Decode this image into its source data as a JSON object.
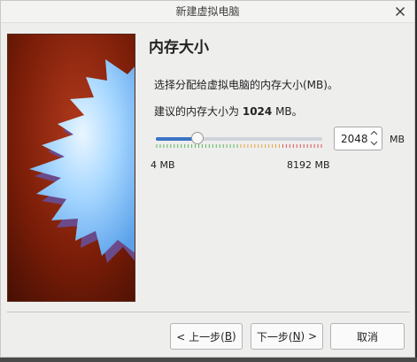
{
  "window": {
    "title": "新建虚拟电脑"
  },
  "page": {
    "heading": "内存大小",
    "description": "选择分配给虚拟电脑的内存大小(MB)。",
    "recommend_prefix": "建议的内存大小为",
    "recommend_value": "1024",
    "recommend_suffix": "MB。"
  },
  "memory": {
    "value": "2048",
    "min_label": "4 MB",
    "max_label": "8192 MB",
    "unit": "MB",
    "min": 4,
    "max": 8192,
    "current": 2048,
    "recommended": 1024,
    "colors": {
      "accent": "#3b74c6",
      "safe": "#5cb85c",
      "warn": "#e8a33d",
      "danger": "#d9534f"
    }
  },
  "buttons": {
    "back": {
      "text": "< 上一步(",
      "key": "B",
      "close": ")"
    },
    "next": {
      "text": "下一步(",
      "key": "N",
      "close": ") >"
    },
    "cancel": "取消"
  },
  "icons": {
    "close": "close-icon",
    "spin_up": "chevron-up-icon",
    "spin_down": "chevron-down-icon",
    "art": "starburst-illustration"
  }
}
